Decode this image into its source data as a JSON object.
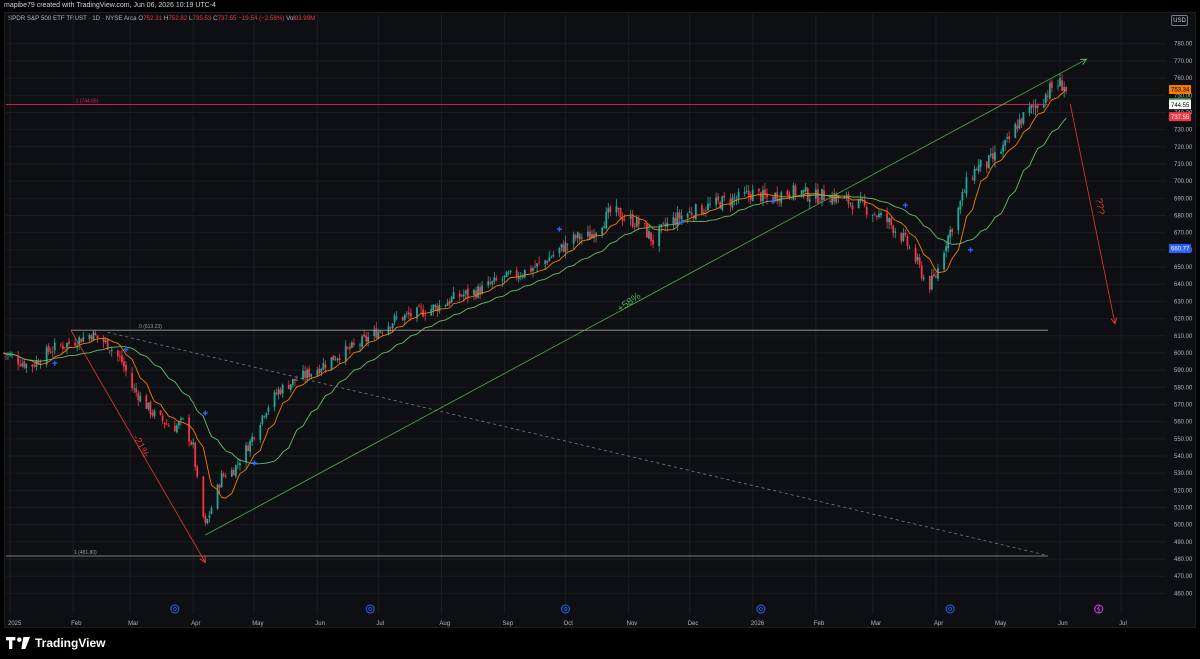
{
  "credit": "mapibe79 created with TradingView.com, Jun 06, 2026 10:19 UTC-4",
  "symbol_line": {
    "name": "SPDR S&P 500 ETF TRUST · 1D · NYSE Arca",
    "open_label": "O",
    "open": "752.31",
    "high_label": "H",
    "high": "752.82",
    "low_label": "L",
    "low": "735.53",
    "close_label": "C",
    "close": "737.55",
    "change": "−19.54 (−2.58%)",
    "vol_label": "Vol",
    "vol": "83.99M"
  },
  "currency": "USD",
  "brand": "TradingView",
  "colors": {
    "up": "#26a69a",
    "down": "#f23645",
    "ma_fast": "#f57c00",
    "ma_slow": "#66bb6a",
    "trend_up": "#4caf50",
    "trend_down": "#e53935",
    "fib_line": "#e91e63",
    "fib_level": "#9e9e9e",
    "marker": "#2962ff"
  },
  "chart_data": {
    "type": "candlestick",
    "y_range": [
      455,
      788
    ],
    "y_ticks": [
      460,
      470,
      480,
      490,
      500,
      510,
      520,
      530,
      540,
      550,
      560,
      570,
      580,
      590,
      600,
      610,
      620,
      630,
      640,
      650,
      660,
      670,
      680,
      690,
      700,
      710,
      720,
      730,
      740,
      750,
      760,
      770,
      780
    ],
    "x_ticks": [
      {
        "label": "2025",
        "day": 0
      },
      {
        "label": "Feb",
        "day": 31
      },
      {
        "label": "Mar",
        "day": 59
      },
      {
        "label": "Apr",
        "day": 90
      },
      {
        "label": "May",
        "day": 120
      },
      {
        "label": "Jun",
        "day": 151
      },
      {
        "label": "Jul",
        "day": 181
      },
      {
        "label": "Aug",
        "day": 212
      },
      {
        "label": "Sep",
        "day": 243
      },
      {
        "label": "Oct",
        "day": 273
      },
      {
        "label": "Nov",
        "day": 304
      },
      {
        "label": "Dec",
        "day": 334
      },
      {
        "label": "2026",
        "day": 365
      },
      {
        "label": "Feb",
        "day": 396
      },
      {
        "label": "Mar",
        "day": 424
      },
      {
        "label": "Apr",
        "day": 455
      },
      {
        "label": "May",
        "day": 485
      },
      {
        "label": "Jun",
        "day": 516
      },
      {
        "label": "Jul",
        "day": 546
      }
    ],
    "x_tick_note": "day = calendar days since Jan 1 2025",
    "price_path": [
      [
        -3,
        600
      ],
      [
        10,
        592
      ],
      [
        20,
        602
      ],
      [
        30,
        606
      ],
      [
        40,
        611
      ],
      [
        48,
        605
      ],
      [
        55,
        595
      ],
      [
        60,
        580
      ],
      [
        70,
        565
      ],
      [
        80,
        556
      ],
      [
        85,
        560
      ],
      [
        90,
        545
      ],
      [
        93,
        515
      ],
      [
        96,
        499
      ],
      [
        99,
        510
      ],
      [
        104,
        528
      ],
      [
        110,
        532
      ],
      [
        118,
        548
      ],
      [
        125,
        566
      ],
      [
        132,
        578
      ],
      [
        140,
        584
      ],
      [
        150,
        590
      ],
      [
        160,
        598
      ],
      [
        170,
        604
      ],
      [
        180,
        612
      ],
      [
        190,
        620
      ],
      [
        200,
        623
      ],
      [
        210,
        627
      ],
      [
        220,
        633
      ],
      [
        230,
        636
      ],
      [
        240,
        642
      ],
      [
        250,
        646
      ],
      [
        260,
        651
      ],
      [
        270,
        660
      ],
      [
        278,
        667
      ],
      [
        285,
        668
      ],
      [
        290,
        675
      ],
      [
        296,
        683
      ],
      [
        303,
        678
      ],
      [
        310,
        675
      ],
      [
        316,
        665
      ],
      [
        322,
        674
      ],
      [
        330,
        680
      ],
      [
        340,
        684
      ],
      [
        350,
        688
      ],
      [
        358,
        690
      ],
      [
        365,
        693
      ],
      [
        372,
        690
      ],
      [
        380,
        693
      ],
      [
        388,
        694
      ],
      [
        395,
        691
      ],
      [
        402,
        692
      ],
      [
        410,
        689
      ],
      [
        418,
        686
      ],
      [
        424,
        682
      ],
      [
        432,
        676
      ],
      [
        440,
        665
      ],
      [
        446,
        652
      ],
      [
        451,
        638
      ],
      [
        455,
        645
      ],
      [
        460,
        665
      ],
      [
        465,
        680
      ],
      [
        470,
        698
      ],
      [
        475,
        708
      ],
      [
        480,
        710
      ],
      [
        485,
        715
      ],
      [
        490,
        722
      ],
      [
        495,
        733
      ],
      [
        500,
        740
      ],
      [
        505,
        745
      ],
      [
        510,
        752
      ],
      [
        514,
        757
      ],
      [
        518,
        756
      ],
      [
        520,
        748
      ],
      [
        521,
        737.55
      ]
    ],
    "candles_note": "Daily OHLC candles around this price path; last close 737.55",
    "moving_averages": [
      {
        "name": "fast MA",
        "color": "ma_fast"
      },
      {
        "name": "slow MA",
        "color": "ma_slow"
      }
    ],
    "price_labels": [
      {
        "value": "753.34",
        "bg": "#f57c00",
        "fg": "#000",
        "y": 753.34
      },
      {
        "value": "745.59",
        "bg": "#66bb6a",
        "fg": "#000",
        "y": 745.59
      },
      {
        "value": "744.55",
        "bg": "#ffffff",
        "fg": "#000",
        "y": 744.55
      },
      {
        "value": "737.55",
        "bg": "#f23645",
        "fg": "#fff",
        "y": 737.55
      },
      {
        "value": "660.77",
        "bg": "#2962ff",
        "fg": "#fff",
        "y": 660.77
      }
    ],
    "fib_levels": [
      {
        "label": "-1 (744.66)",
        "price": 744.66,
        "x1_day": -2,
        "x2_day": 510,
        "color": "fib_line"
      },
      {
        "label": "0 (613.23)",
        "price": 613.23,
        "x1_day": 30,
        "x2_day": 510,
        "color": "fib_level"
      },
      {
        "label": "1 (481.80)",
        "price": 481.8,
        "x1_day": -2,
        "x2_day": 510,
        "color": "fib_level"
      }
    ],
    "trendlines": [
      {
        "name": "down-move",
        "from": [
          30,
          613
        ],
        "to": [
          96,
          478
        ],
        "color": "trend_down",
        "arrow": true
      },
      {
        "name": "up-channel",
        "from": [
          96,
          494
        ],
        "to": [
          529,
          771
        ],
        "color": "trend_up",
        "arrow": true
      },
      {
        "name": "projection",
        "from": [
          521,
          745
        ],
        "to": [
          543,
          617
        ],
        "color": "trend_down",
        "arrow": true
      },
      {
        "name": "dotted-down",
        "from": [
          48,
          612
        ],
        "to": [
          510,
          482
        ],
        "color": "#787b86",
        "dashed": true
      }
    ],
    "annotations": [
      {
        "text": "-21%",
        "day": 63,
        "price": 545,
        "color": "trend_down",
        "rotate": 62
      },
      {
        "text": "+58%",
        "day": 305,
        "price": 628,
        "color": "trend_up",
        "rotate": -35
      },
      {
        "text": "???",
        "day": 534,
        "price": 685,
        "color": "trend_down",
        "rotate": 80
      }
    ],
    "event_markers_days": [
      81,
      177,
      273,
      369,
      462
    ],
    "flash_marker_day": 535,
    "cross_markers": [
      [
        22,
        594
      ],
      [
        57,
        602
      ],
      [
        96,
        565
      ],
      [
        120,
        536
      ],
      [
        270,
        672
      ],
      [
        330,
        676
      ],
      [
        375,
        688
      ],
      [
        440,
        686
      ],
      [
        472,
        660
      ]
    ]
  }
}
